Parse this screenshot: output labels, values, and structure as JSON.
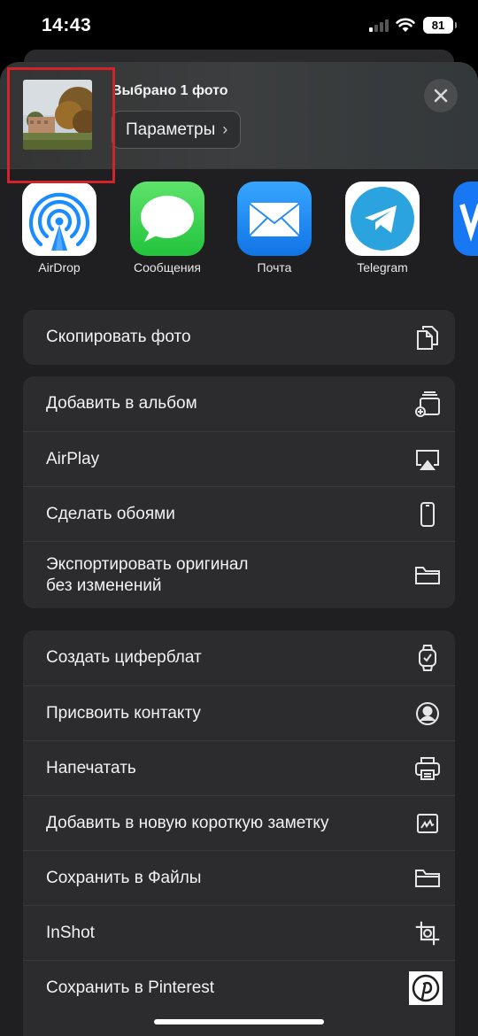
{
  "status_bar": {
    "time": "14:43",
    "battery": "81"
  },
  "header": {
    "title": "Выбрано 1 фото",
    "params_label": "Параметры",
    "params_chevron": "›"
  },
  "apps": [
    {
      "label": "AirDrop",
      "icon": "airdrop-icon",
      "color": "#ffffff"
    },
    {
      "label": "Сообщения",
      "icon": "messages-icon",
      "color": "#34c759"
    },
    {
      "label": "Почта",
      "icon": "mail-icon",
      "color": "#1e8ff0"
    },
    {
      "label": "Telegram",
      "icon": "telegram-icon",
      "color": "#2aa3df"
    }
  ],
  "groups": [
    {
      "items": [
        {
          "label": "Скопировать фото",
          "icon": "copy-icon"
        }
      ]
    },
    {
      "items": [
        {
          "label": "Добавить в альбом",
          "icon": "add-to-album-icon"
        },
        {
          "label": "AirPlay",
          "icon": "airplay-icon"
        },
        {
          "label": "Сделать обоями",
          "icon": "phone-icon"
        },
        {
          "label_line1": "Экспортировать оригинал",
          "label_line2": "без изменений",
          "icon": "folder-icon"
        }
      ]
    },
    {
      "items": [
        {
          "label": "Создать циферблат",
          "icon": "watch-icon"
        },
        {
          "label": "Присвоить контакту",
          "icon": "contact-icon"
        },
        {
          "label": "Напечатать",
          "icon": "printer-icon"
        },
        {
          "label": "Добавить в новую короткую заметку",
          "icon": "quick-note-icon"
        },
        {
          "label": "Сохранить в Файлы",
          "icon": "folder-icon"
        },
        {
          "label": "InShot",
          "icon": "inshot-icon"
        },
        {
          "label": "Сохранить в Pinterest",
          "icon": "pinterest-icon"
        }
      ]
    }
  ],
  "colors": {
    "sheet_bg": "#1f1f21",
    "group_bg": "#2c2c2e",
    "highlight_border": "#d2232a",
    "airdrop_blue": "#1a8cff"
  }
}
